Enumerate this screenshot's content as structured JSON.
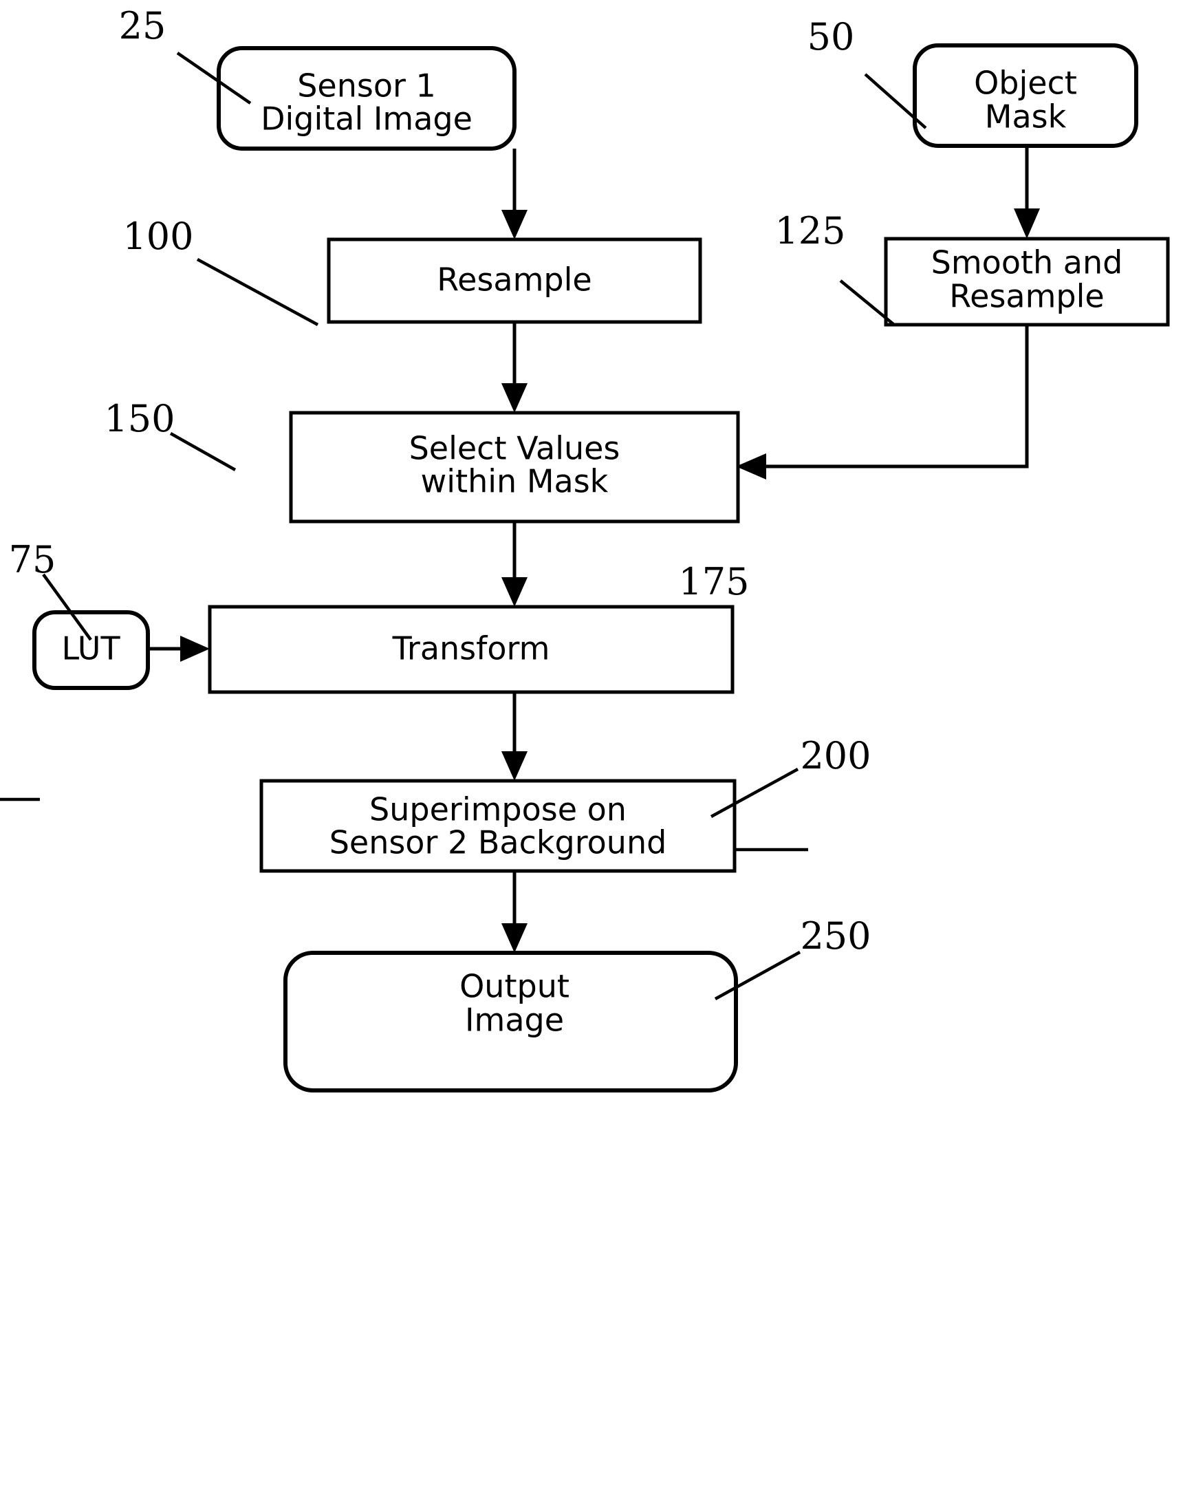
{
  "diagram": {
    "type": "flowchart",
    "title": "Image processing flowchart",
    "nodes": [
      {
        "id": "sensor1",
        "ref": "25",
        "shape": "rounded-rectangle",
        "lines": [
          "Sensor 1",
          "Digital Image"
        ]
      },
      {
        "id": "object_mask",
        "ref": "50",
        "shape": "rounded-rectangle",
        "lines": [
          "Object",
          "Mask"
        ]
      },
      {
        "id": "resample",
        "ref": "100",
        "shape": "rectangle",
        "lines": [
          "Resample"
        ]
      },
      {
        "id": "smooth_resample",
        "ref": "125",
        "shape": "rectangle",
        "lines": [
          "Smooth and",
          "Resample"
        ]
      },
      {
        "id": "select_values",
        "ref": "150",
        "shape": "rectangle",
        "lines": [
          "Select Values",
          "within Mask"
        ]
      },
      {
        "id": "lut",
        "ref": "75",
        "shape": "rounded-rectangle",
        "lines": [
          "LUT"
        ]
      },
      {
        "id": "transform",
        "ref": "175",
        "shape": "rectangle",
        "lines": [
          "Transform"
        ]
      },
      {
        "id": "superimpose",
        "ref": "200",
        "shape": "rectangle",
        "lines": [
          "Superimpose on",
          "Sensor 2  Background"
        ]
      },
      {
        "id": "output_image",
        "ref": "250",
        "shape": "rounded-rectangle",
        "lines": [
          "Output",
          "Image"
        ]
      }
    ],
    "edges": [
      {
        "from": "sensor1",
        "to": "resample",
        "style": "arrow-down"
      },
      {
        "from": "object_mask",
        "to": "smooth_resample",
        "style": "arrow-down"
      },
      {
        "from": "resample",
        "to": "select_values",
        "style": "arrow-down"
      },
      {
        "from": "smooth_resample",
        "to": "select_values",
        "style": "elbow-arrow-left"
      },
      {
        "from": "select_values",
        "to": "transform",
        "style": "arrow-down"
      },
      {
        "from": "lut",
        "to": "transform",
        "style": "arrow-right"
      },
      {
        "from": "transform",
        "to": "superimpose",
        "style": "arrow-down"
      },
      {
        "from": "superimpose",
        "to": "output_image",
        "style": "arrow-down"
      }
    ],
    "colors": {
      "stroke": "#000000",
      "fill": "#ffffff",
      "text": "#000000"
    }
  }
}
